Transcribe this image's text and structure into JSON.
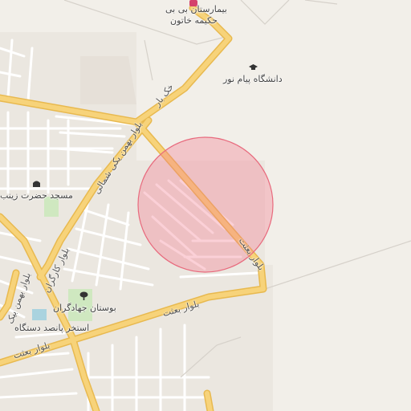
{
  "map": {
    "colors": {
      "background": "#f2efe9",
      "major_road": "#f7d37a",
      "major_road_casing": "#e8b94f",
      "minor_road": "#ffffff",
      "minor_road_casing": "#d9d5cf",
      "park": "#cfe8c0",
      "water": "#aad3df",
      "circle_fill": "rgba(244,120,140,0.35)",
      "circle_stroke": "#e86a7d"
    },
    "pois": {
      "hospital": {
        "name_line1": "بیمارستان بی بی",
        "name_line2": "حکیمه خاتون",
        "icon": "hospital-icon"
      },
      "university": {
        "name": "دانشگاه پیام نور",
        "icon": "graduation-cap-icon"
      },
      "mosque": {
        "name": "مسجد حضرت زینب",
        "icon": "mosque-icon"
      },
      "park": {
        "name": "بوستان جهادگران",
        "icon": "tree-icon"
      },
      "pool": {
        "name": "استخر پانصد دستگاه"
      }
    },
    "roads": {
      "khakbar": "خک بار",
      "bahman_north": "بلوار بهمن یکی شمالی",
      "besat_vertical": "بلوار بعثت",
      "besat_south": "بلوار بعثت",
      "besat_southwest": "بلوار بعثت",
      "kargaran": "بلوار کارگران",
      "bahman_left": "بلوار بهمن بیک"
    }
  }
}
